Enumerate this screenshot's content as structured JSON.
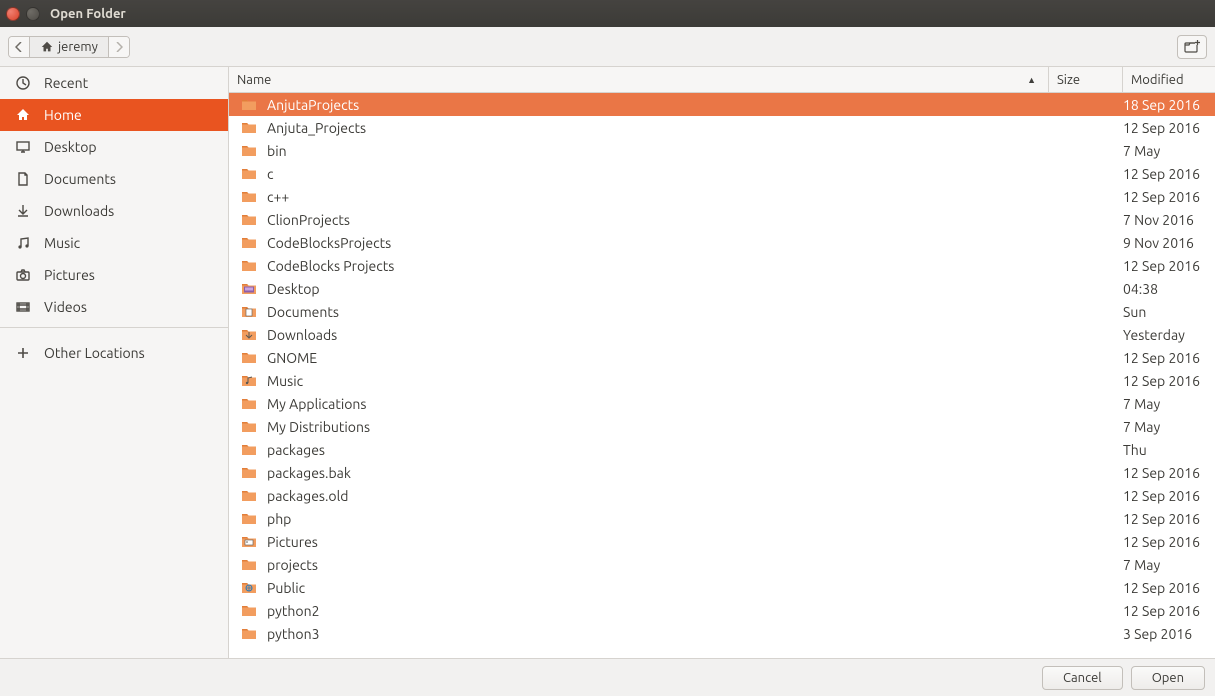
{
  "window": {
    "title": "Open Folder"
  },
  "breadcrumb": {
    "current": "jeremy"
  },
  "sidebar": {
    "items": [
      {
        "label": "Recent",
        "icon": "clock"
      },
      {
        "label": "Home",
        "icon": "home",
        "active": true
      },
      {
        "label": "Desktop",
        "icon": "desktop"
      },
      {
        "label": "Documents",
        "icon": "document"
      },
      {
        "label": "Downloads",
        "icon": "download"
      },
      {
        "label": "Music",
        "icon": "music"
      },
      {
        "label": "Pictures",
        "icon": "camera"
      },
      {
        "label": "Videos",
        "icon": "video"
      }
    ],
    "other": {
      "label": "Other Locations"
    }
  },
  "columns": {
    "name": "Name",
    "size": "Size",
    "modified": "Modified"
  },
  "files": [
    {
      "name": "AnjutaProjects",
      "size": "",
      "modified": "18 Sep 2016",
      "icon": "folder",
      "selected": true
    },
    {
      "name": "Anjuta_Projects",
      "size": "",
      "modified": "12 Sep 2016",
      "icon": "folder"
    },
    {
      "name": "bin",
      "size": "",
      "modified": "7 May",
      "icon": "folder"
    },
    {
      "name": "c",
      "size": "",
      "modified": "12 Sep 2016",
      "icon": "folder"
    },
    {
      "name": "c++",
      "size": "",
      "modified": "12 Sep 2016",
      "icon": "folder"
    },
    {
      "name": "ClionProjects",
      "size": "",
      "modified": "7 Nov 2016",
      "icon": "folder"
    },
    {
      "name": "CodeBlocksProjects",
      "size": "",
      "modified": "9 Nov 2016",
      "icon": "folder"
    },
    {
      "name": "CodeBlocks Projects",
      "size": "",
      "modified": "12 Sep 2016",
      "icon": "folder"
    },
    {
      "name": "Desktop",
      "size": "",
      "modified": "04:38",
      "icon": "desktop-folder"
    },
    {
      "name": "Documents",
      "size": "",
      "modified": "Sun",
      "icon": "documents-folder"
    },
    {
      "name": "Downloads",
      "size": "",
      "modified": "Yesterday",
      "icon": "downloads-folder"
    },
    {
      "name": "GNOME",
      "size": "",
      "modified": "12 Sep 2016",
      "icon": "folder"
    },
    {
      "name": "Music",
      "size": "",
      "modified": "12 Sep 2016",
      "icon": "music-folder"
    },
    {
      "name": "My Applications",
      "size": "",
      "modified": "7 May",
      "icon": "folder"
    },
    {
      "name": "My Distributions",
      "size": "",
      "modified": "7 May",
      "icon": "folder"
    },
    {
      "name": "packages",
      "size": "",
      "modified": "Thu",
      "icon": "folder"
    },
    {
      "name": "packages.bak",
      "size": "",
      "modified": "12 Sep 2016",
      "icon": "folder"
    },
    {
      "name": "packages.old",
      "size": "",
      "modified": "12 Sep 2016",
      "icon": "folder"
    },
    {
      "name": "php",
      "size": "",
      "modified": "12 Sep 2016",
      "icon": "folder"
    },
    {
      "name": "Pictures",
      "size": "",
      "modified": "12 Sep 2016",
      "icon": "pictures-folder"
    },
    {
      "name": "projects",
      "size": "",
      "modified": "7 May",
      "icon": "folder"
    },
    {
      "name": "Public",
      "size": "",
      "modified": "12 Sep 2016",
      "icon": "public-folder"
    },
    {
      "name": "python2",
      "size": "",
      "modified": "12 Sep 2016",
      "icon": "folder"
    },
    {
      "name": "python3",
      "size": "",
      "modified": "3 Sep 2016",
      "icon": "folder"
    }
  ],
  "footer": {
    "cancel": "Cancel",
    "open": "Open"
  }
}
